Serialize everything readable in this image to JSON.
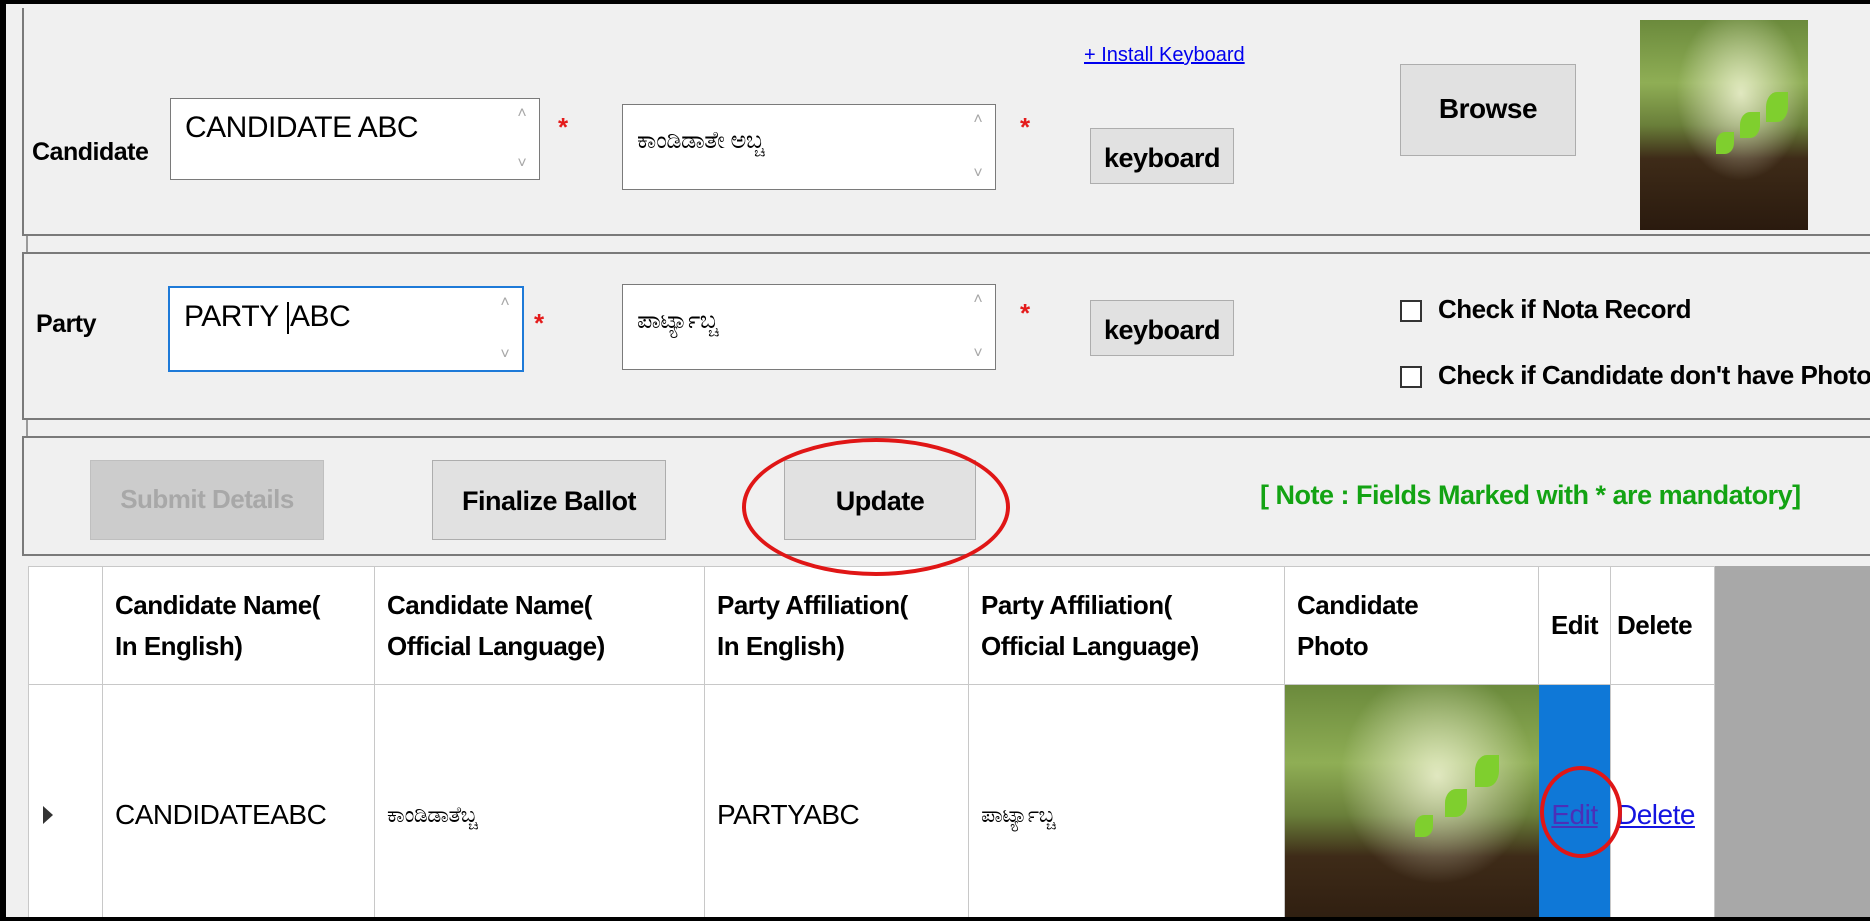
{
  "candidate": {
    "label": "Candidate",
    "name_english": "CANDIDATE ABC",
    "name_official": "ಕಾಂಡಿಡಾತೇ ಅಬ್ಚ",
    "install_keyboard_link": "+ Install Keyboard",
    "keyboard_button": "keyboard",
    "browse_button": "Browse",
    "required_mark": "*"
  },
  "party": {
    "label": "Party",
    "name_english_before_caret": "PARTY ",
    "name_english_after_caret": "ABC",
    "name_official": "ಪಾರ್ಟ್ಯಾಬ್ಚ",
    "keyboard_button": "keyboard",
    "nota_checkbox_label": "Check if Nota Record",
    "no_photo_checkbox_label": "Check if Candidate don't have Photo",
    "nota_checked": false,
    "no_photo_checked": false
  },
  "actions": {
    "submit_button": "Submit Details",
    "finalize_button": "Finalize Ballot",
    "update_button": "Update",
    "note": "[ Note : Fields Marked with * are mandatory]"
  },
  "grid": {
    "headers": {
      "cand_en_1": "Candidate Name(",
      "cand_en_2": "In English)",
      "cand_off_1": "Candidate Name(",
      "cand_off_2": "Official Language)",
      "party_en_1": "Party Affiliation(",
      "party_en_2": "In English)",
      "party_off_1": "Party Affiliation(",
      "party_off_2": "Official Language)",
      "photo_1": "Candidate",
      "photo_2": "Photo",
      "edit": "Edit",
      "delete": "Delete"
    },
    "rows": [
      {
        "cand_en": "CANDIDATEABC",
        "cand_off": "ಕಾಂಡಿಡಾತೆಬ್ಚ",
        "party_en": "PARTYABC",
        "party_off": "ಪಾರ್ಟ್ಯಾಬ್ಚ",
        "edit": "Edit",
        "delete": "Delete"
      }
    ]
  },
  "colors": {
    "accent_focus": "#1e7ad8",
    "required": "#e41b1b",
    "note_green": "#13a313",
    "selected_cell": "#0f78d7",
    "highlight_ring": "#e01616"
  }
}
